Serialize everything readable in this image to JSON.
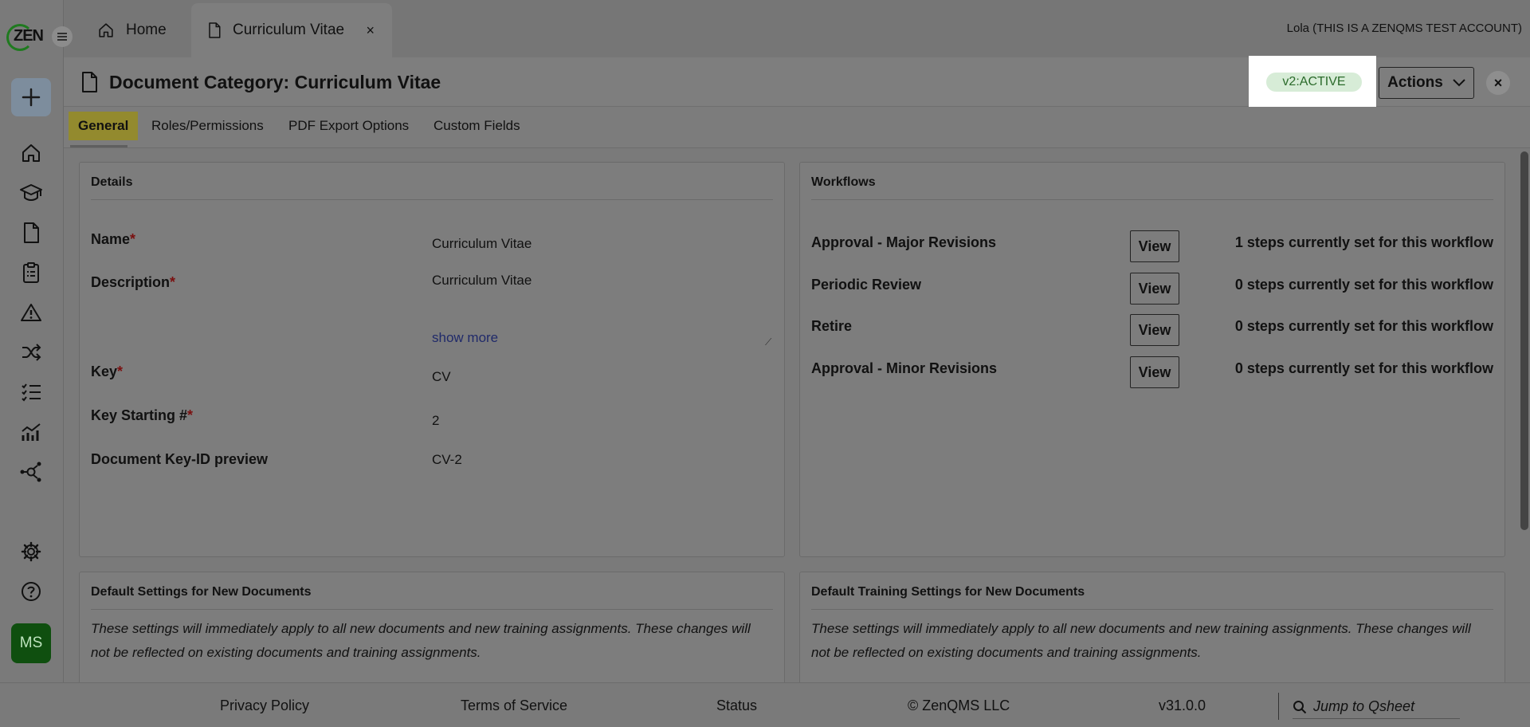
{
  "sidebar": {
    "logo_text": "ZEN",
    "avatar_initials": "MS",
    "nav_icons": [
      "home-icon",
      "training-icon",
      "document-icon",
      "clipboard-icon",
      "warning-icon",
      "shuffle-icon",
      "checklist-icon",
      "analytics-icon",
      "network-icon",
      "settings-icon",
      "help-icon"
    ]
  },
  "topbar": {
    "tabs": [
      {
        "label": "Home",
        "icon": "home-icon"
      },
      {
        "label": "Curriculum Vitae",
        "icon": "document-icon",
        "close": "×"
      }
    ],
    "account": "Lola (THIS IS A ZENQMS TEST ACCOUNT)"
  },
  "header": {
    "title": "Document Category: Curriculum Vitae",
    "status": "v2:ACTIVE",
    "actions_label": "Actions",
    "close": "×"
  },
  "subtabs": [
    "General",
    "Roles/Permissions",
    "PDF Export Options",
    "Custom Fields"
  ],
  "details": {
    "title": "Details",
    "required_mark": "*",
    "fields": [
      {
        "label": "Name",
        "value": "Curriculum Vitae"
      },
      {
        "label": "Description",
        "value": "Curriculum Vitae",
        "show_more": "show more"
      },
      {
        "label": "Key",
        "value": "CV"
      },
      {
        "label": "Key Starting #",
        "value": "2"
      },
      {
        "label": "Document Key-ID preview",
        "value": "CV-2"
      }
    ]
  },
  "workflows": {
    "title": "Workflows",
    "view_label": "View",
    "items": [
      {
        "name": "Approval - Major Revisions",
        "steps": "1 steps currently set for this workflow"
      },
      {
        "name": "Periodic Review",
        "steps": "0 steps currently set for this workflow"
      },
      {
        "name": "Retire",
        "steps": "0 steps currently set for this workflow"
      },
      {
        "name": "Approval - Minor Revisions",
        "steps": "0 steps currently set for this workflow"
      }
    ]
  },
  "defaults": {
    "title": "Default Settings for New Documents",
    "notice": "These settings will immediately apply to all new documents and new training assignments. These changes will not be reflected on existing documents and training assignments."
  },
  "training_defaults": {
    "title": "Default Training Settings for New Documents",
    "notice": "These settings will immediately apply to all new documents and new training assignments. These changes will not be reflected on existing documents and training assignments."
  },
  "footer": {
    "links": [
      "Privacy Policy",
      "Terms of Service",
      "Status",
      "© ZenQMS LLC",
      "v31.0.0"
    ],
    "jump_placeholder": "Jump to Qsheet"
  },
  "colors": {
    "status_pill_bg": "#d7ecd7",
    "status_pill_text": "#2b6b2b",
    "active_tab": "#938a2e",
    "avatar": "#0f4f0f"
  }
}
